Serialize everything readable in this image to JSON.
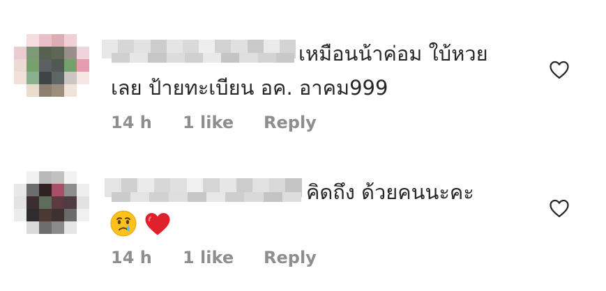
{
  "comments": [
    {
      "text_line1": "เหมือนน้าค่อม ใบ้หวย",
      "text_line2": "เลย ป้ายทะเบียน อค. อาคม999",
      "time": "14 h",
      "likes": "1 like",
      "reply_label": "Reply",
      "like_icon": "heart-outline-icon"
    },
    {
      "text_line1": "คิดถึง ด้วยคนนะคะ",
      "emojis": [
        "crying-face-emoji",
        "red-heart-emoji"
      ],
      "time": "14 h",
      "likes": "1 like",
      "reply_label": "Reply",
      "like_icon": "heart-outline-icon"
    }
  ],
  "colors": {
    "text": "#262626",
    "meta": "#8e8e8e",
    "heart_red": "#e0212b"
  }
}
